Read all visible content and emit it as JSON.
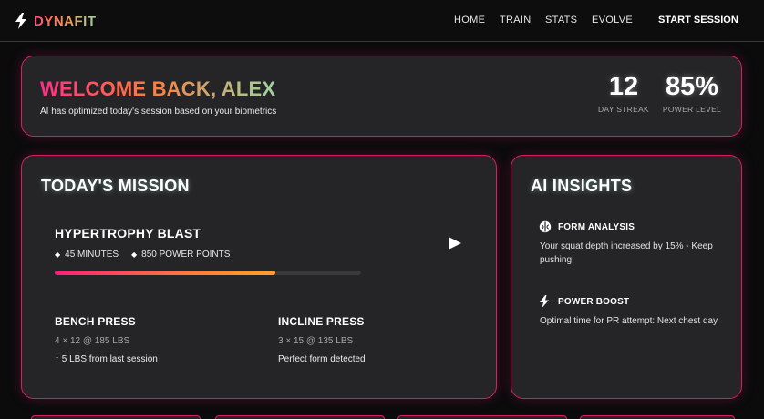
{
  "brand": {
    "name": "DYNAFIT",
    "icon": "lightning-bolt-icon"
  },
  "nav": {
    "links": [
      "HOME",
      "TRAIN",
      "STATS",
      "EVOLVE"
    ],
    "cta": "START SESSION"
  },
  "welcome": {
    "title": "WELCOME BACK, ALEX",
    "subtitle": "AI has optimized today's session based on your biometrics",
    "stats": [
      {
        "value": "12",
        "label": "DAY STREAK"
      },
      {
        "value": "85%",
        "label": "POWER LEVEL"
      }
    ]
  },
  "mission": {
    "title": "TODAY'S MISSION",
    "workout": {
      "name": "HYPERTROPHY BLAST",
      "duration": "45 MINUTES",
      "points": "850 POWER POINTS",
      "progress": 0.72
    },
    "exercises": [
      {
        "name": "BENCH PRESS",
        "sets": "4 × 12 @ 185 LBS",
        "note": "↑ 5 LBS from last session"
      },
      {
        "name": "INCLINE PRESS",
        "sets": "3 × 15 @ 135 LBS",
        "note": "Perfect form detected"
      }
    ]
  },
  "insights": {
    "title": "AI INSIGHTS",
    "items": [
      {
        "icon": "brain-icon",
        "heading": "FORM ANALYSIS",
        "body": "Your squat depth increased by 15% - Keep pushing!"
      },
      {
        "icon": "lightning-bolt-icon",
        "heading": "POWER BOOST",
        "body": "Optimal time for PR attempt: Next chest day"
      }
    ]
  },
  "colors": {
    "accent_border": "#d61f63",
    "card_bg": "#252527",
    "page_bg": "#0b0b0c",
    "gradient_start": "#ff2d87",
    "gradient_mid": "#ff7a3d",
    "gradient_end": "#9ed59f"
  }
}
